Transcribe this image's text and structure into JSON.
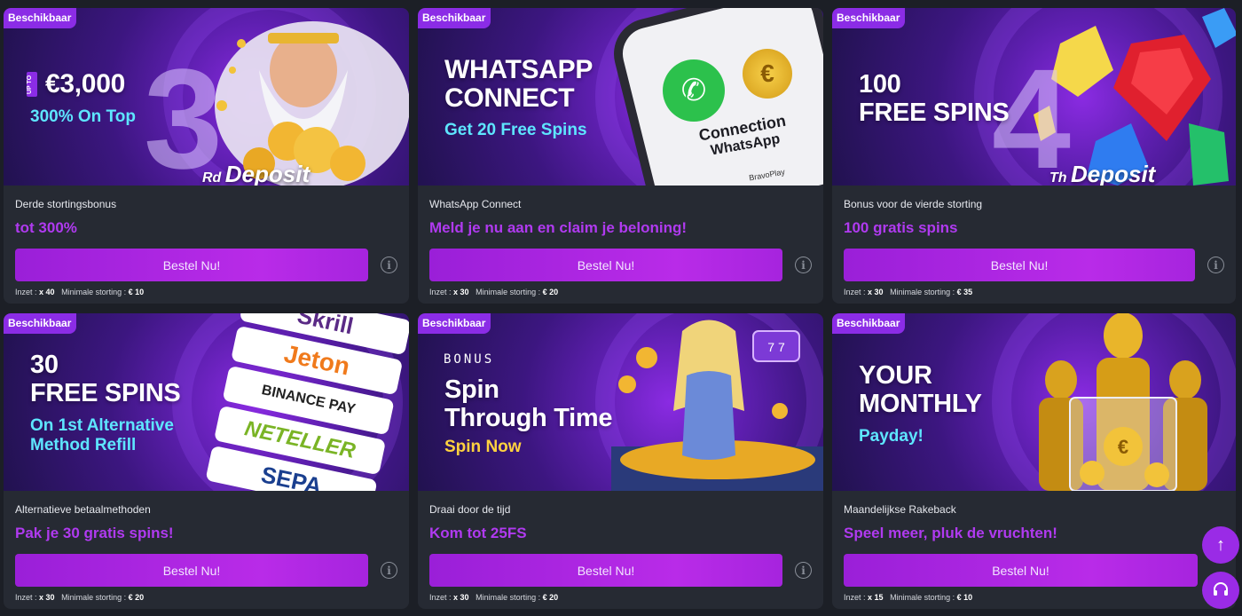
{
  "cards": [
    {
      "badge": "Beschikbaar",
      "headline_upto": "UP TO",
      "headline": "€3,000",
      "sub": "300% On Top",
      "big_number": "3",
      "deposit_prefix": "Rd",
      "deposit_word": "Deposit",
      "title": "Derde stortingsbonus",
      "promo": "tot 300%",
      "button": "Bestel Nu!",
      "meta_wager_label": "Inzet :",
      "meta_wager": "x 40",
      "meta_min_label": "Minimale storting :",
      "meta_min": "€ 10"
    },
    {
      "badge": "Beschikbaar",
      "headline_line1": "WHATSAPP",
      "headline_line2": "CONNECT",
      "sub": "Get 20 Free Spins",
      "phone_text_line1": "Connection",
      "phone_text_line2": "WhatsApp",
      "phone_brand": "BravoPlay",
      "title": "WhatsApp Connect",
      "promo": "Meld je nu aan en claim je beloning!",
      "button": "Bestel Nu!",
      "meta_wager_label": "Inzet :",
      "meta_wager": "x 30",
      "meta_min_label": "Minimale storting :",
      "meta_min": "€ 20"
    },
    {
      "badge": "Beschikbaar",
      "headline_line1": "100",
      "headline_line2": "FREE SPINS",
      "big_number": "4",
      "deposit_prefix": "Th",
      "deposit_word": "Deposit",
      "title": "Bonus voor de vierde storting",
      "promo": "100 gratis spins",
      "button": "Bestel Nu!",
      "meta_wager_label": "Inzet :",
      "meta_wager": "x 30",
      "meta_min_label": "Minimale storting :",
      "meta_min": "€ 35"
    },
    {
      "badge": "Beschikbaar",
      "headline_line1": "30",
      "headline_line2": "FREE SPINS",
      "sub_line1": "On 1st Alternative",
      "sub_line2": "Method Refill",
      "methods": [
        "Skrill",
        "Jeton",
        "BINANCE PAY",
        "NETELLER",
        "SEPA"
      ],
      "title": "Alternatieve betaalmethoden",
      "promo": "Pak je 30 gratis spins!",
      "button": "Bestel Nu!",
      "meta_wager_label": "Inzet :",
      "meta_wager": "x 30",
      "meta_min_label": "Minimale storting :",
      "meta_min": "€ 20"
    },
    {
      "badge": "Beschikbaar",
      "eyebrow": "BONUS",
      "headline_line1": "Spin",
      "headline_line2": "Through Time",
      "sub": "Spin Now",
      "title": "Draai door de tijd",
      "promo": "Kom tot 25FS",
      "button": "Bestel Nu!",
      "meta_wager_label": "Inzet :",
      "meta_wager": "x 30",
      "meta_min_label": "Minimale storting :",
      "meta_min": "€ 20"
    },
    {
      "badge": "Beschikbaar",
      "headline_line1": "YOUR",
      "headline_line2": "MONTHLY",
      "sub": "Payday!",
      "title": "Maandelijkse Rakeback",
      "promo": "Speel meer, pluk de vruchten!",
      "button": "Bestel Nu!",
      "meta_wager_label": "Inzet :",
      "meta_wager": "x 15",
      "meta_min_label": "Minimale storting :",
      "meta_min": "€ 10"
    }
  ],
  "icons": {
    "info": "info-icon",
    "scroll_top": "arrow-up-icon",
    "support": "headset-icon"
  },
  "colors": {
    "badge": "#8b2ce6",
    "button": "#b92be8",
    "promo": "#b03af0",
    "accent_cyan": "#5ee6ff",
    "accent_yellow": "#ffd23f",
    "card_bg": "#262a33",
    "page_bg": "#1c1f26"
  }
}
